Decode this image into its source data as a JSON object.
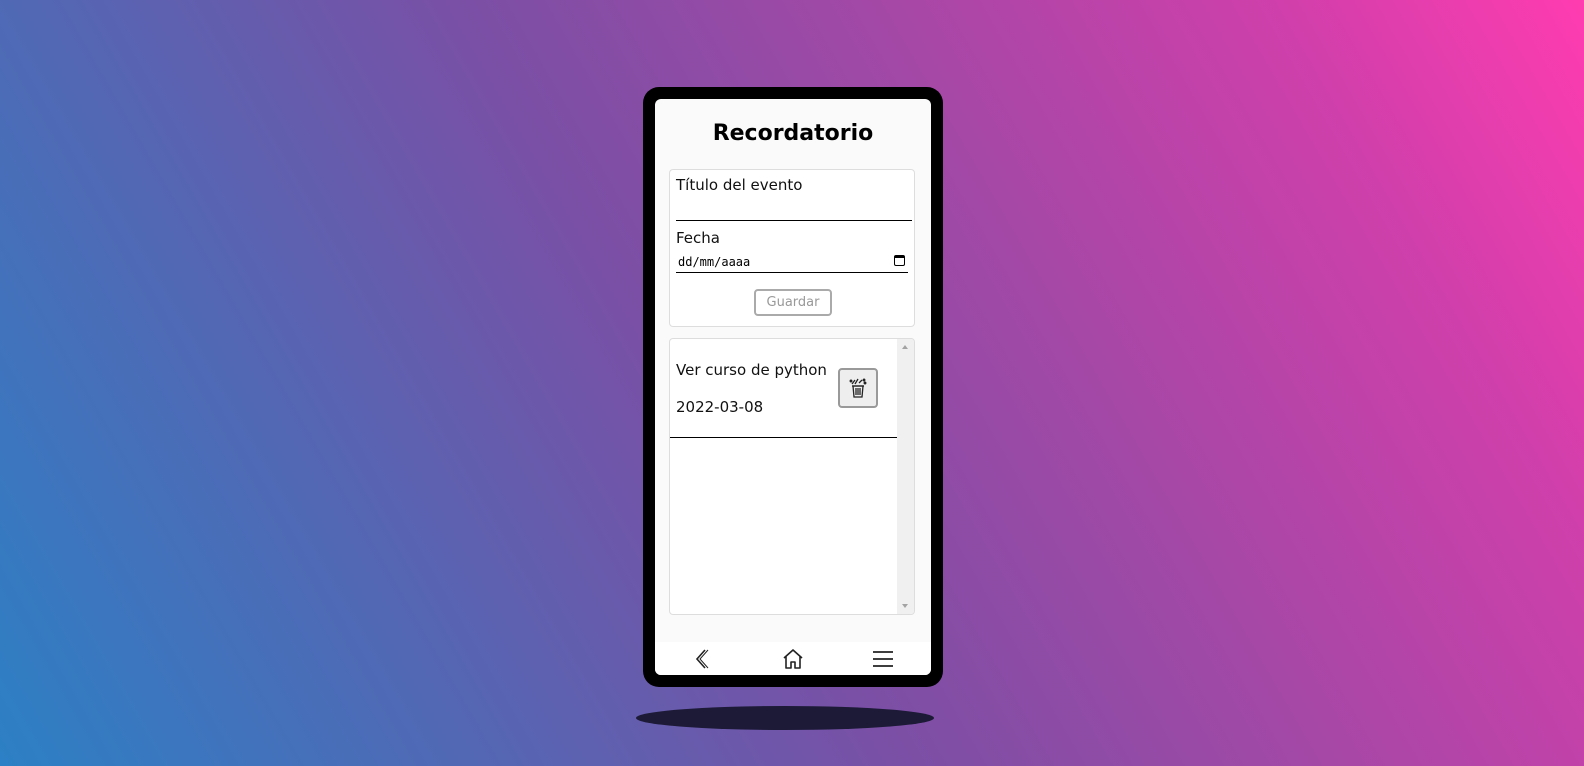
{
  "app": {
    "title": "Recordatorio"
  },
  "form": {
    "title_label": "Título del evento",
    "title_value": "",
    "date_label": "Fecha",
    "date_placeholder": "dd/mm/aaaa",
    "save_label": "Guardar"
  },
  "events": [
    {
      "title": "Ver curso de python",
      "date": "2022-03-08",
      "delete_icon": "trash-icon"
    }
  ],
  "nav": {
    "back_icon": "back-chevron-icon",
    "home_icon": "home-icon",
    "menu_icon": "hamburger-menu-icon"
  },
  "colors": {
    "gradient_start": "#2c80c5",
    "gradient_mid": "#7b4fa5",
    "gradient_end": "#ff3cb0",
    "phone_frame": "#000000",
    "screen_bg": "#fafafa"
  }
}
